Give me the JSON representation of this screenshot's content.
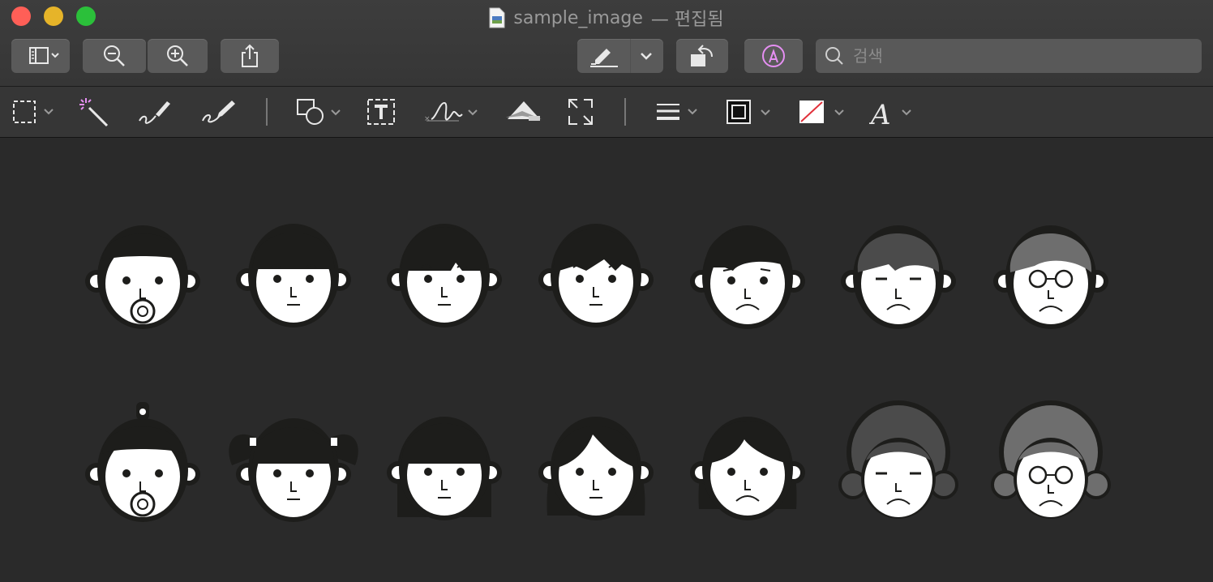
{
  "window": {
    "title": "sample_image",
    "title_status": "— 편집됨"
  },
  "toolbar": {
    "search_placeholder": "검색"
  },
  "icons": {
    "sidebar": "sidebar-icon",
    "zoom_out": "zoom-out-icon",
    "zoom_in": "zoom-in-icon",
    "share": "share-icon",
    "highlight": "highlight-pen-icon",
    "rotate": "rotate-icon",
    "markup": "markup-icon",
    "search": "search-icon"
  },
  "markup_tools": [
    "rectangular-selection-icon",
    "instant-alpha-icon",
    "sketch-icon",
    "draw-icon",
    "shapes-icon",
    "text-icon",
    "sign-icon",
    "adjust-color-icon",
    "adjust-size-icon",
    "line-style-icon",
    "border-color-icon",
    "fill-color-icon",
    "text-style-icon"
  ],
  "colors": {
    "close": "#ff5f57",
    "minimize": "#e6b429",
    "maximize": "#2bc03a",
    "face_dark": "#1d1d1b",
    "face_light": "#ffffff",
    "hair_gray": "#4b4b4b",
    "hair_light_gray": "#6e6e6e",
    "markup_accent": "#e58ff2"
  },
  "faces_row1": [
    "baby-boy",
    "boy",
    "girl-bangs",
    "young-man",
    "man",
    "older-man",
    "elderly-man"
  ],
  "faces_row2": [
    "baby-girl",
    "girl-pigtails",
    "girl-bob",
    "young-woman",
    "woman",
    "older-woman",
    "elderly-woman"
  ]
}
